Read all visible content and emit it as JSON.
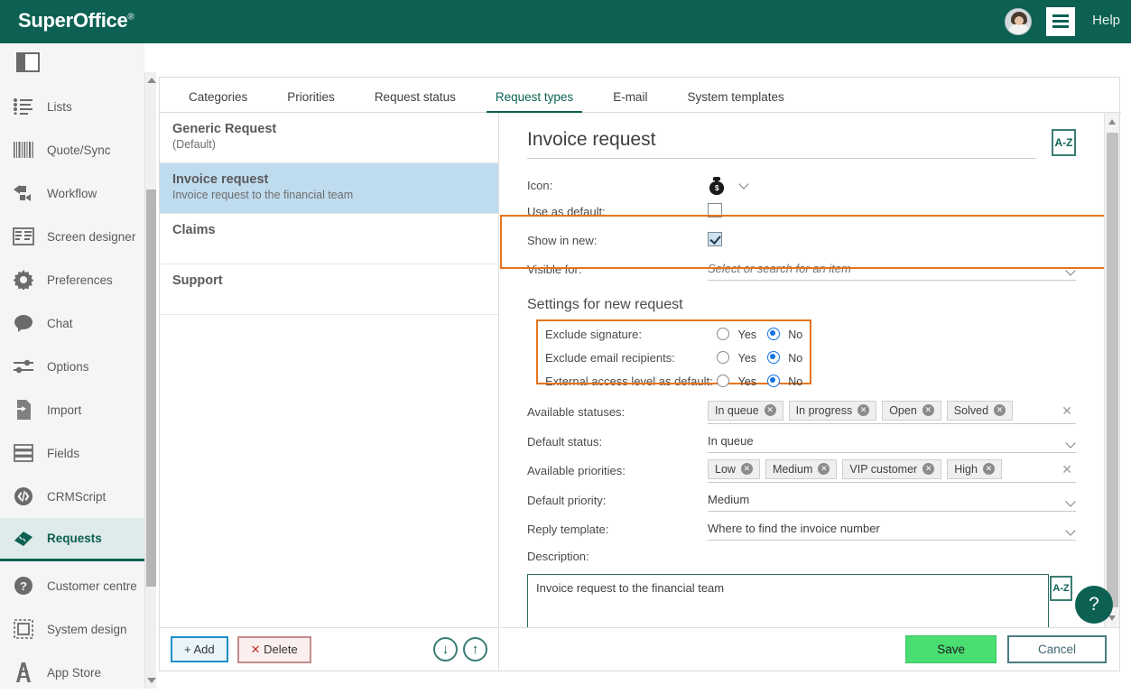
{
  "header": {
    "logo": "SuperOffice",
    "logo_mark": "®",
    "help_label": "Help",
    "brand_color": "#0c6153"
  },
  "sidebar": {
    "panel_toggle_name": "panel-toggle-icon",
    "items": [
      {
        "label": "Lists",
        "icon": "list-icon",
        "active": false
      },
      {
        "label": "Quote/Sync",
        "icon": "barcode-icon",
        "active": false
      },
      {
        "label": "Workflow",
        "icon": "workflow-icon",
        "active": false
      },
      {
        "label": "Screen designer",
        "icon": "screen-designer-icon",
        "active": false
      },
      {
        "label": "Preferences",
        "icon": "gear-icon",
        "active": false
      },
      {
        "label": "Chat",
        "icon": "chat-bubble-icon",
        "active": false
      },
      {
        "label": "Options",
        "icon": "sliders-icon",
        "active": false
      },
      {
        "label": "Import",
        "icon": "import-icon",
        "active": false
      },
      {
        "label": "Fields",
        "icon": "fields-icon",
        "active": false
      },
      {
        "label": "CRMScript",
        "icon": "code-icon",
        "active": false
      },
      {
        "label": "Requests",
        "icon": "ticket-icon",
        "active": true
      },
      {
        "label": "Customer centre",
        "icon": "question-circle-icon",
        "active": false
      },
      {
        "label": "System design",
        "icon": "system-design-icon",
        "active": false
      },
      {
        "label": "App Store",
        "icon": "app-store-icon",
        "active": false
      }
    ]
  },
  "tabs": [
    {
      "label": "Categories",
      "active": false
    },
    {
      "label": "Priorities",
      "active": false
    },
    {
      "label": "Request status",
      "active": false
    },
    {
      "label": "Request types",
      "active": true
    },
    {
      "label": "E-mail",
      "active": false
    },
    {
      "label": "System templates",
      "active": false
    }
  ],
  "request_type_list": [
    {
      "title": "Generic Request",
      "subtitle": "(Default)",
      "selected": false
    },
    {
      "title": "Invoice request",
      "subtitle": "Invoice request to the financial team",
      "selected": true
    },
    {
      "title": "Claims",
      "subtitle": "",
      "selected": false
    },
    {
      "title": "Support",
      "subtitle": "",
      "selected": false
    }
  ],
  "list_footer": {
    "add_label": "Add",
    "add_plus": "+",
    "delete_label": "Delete",
    "delete_x": "✕",
    "move_down_icon": "↓",
    "move_up_icon": "↑"
  },
  "detail": {
    "title": "Invoice request",
    "az_button_label": "A-Z",
    "fields": {
      "icon_label": "Icon:",
      "icon_value": "money-bag-icon",
      "use_as_default_label": "Use as default:",
      "use_as_default_checked": false,
      "show_in_new_label": "Show in new:",
      "show_in_new_checked": true,
      "visible_for_label": "Visible for:",
      "visible_for_placeholder": "Select or search for an item",
      "visible_for_value": ""
    },
    "settings_section": {
      "heading": "Settings for new request",
      "yes_label": "Yes",
      "no_label": "No",
      "rows": [
        {
          "label": "Exclude signature:",
          "value": "No"
        },
        {
          "label": "Exclude email recipients:",
          "value": "No"
        },
        {
          "label": "External access level as default:",
          "value": "No"
        }
      ]
    },
    "available_statuses_label": "Available statuses:",
    "available_statuses": [
      "In queue",
      "In progress",
      "Open",
      "Solved"
    ],
    "default_status_label": "Default status:",
    "default_status": "In queue",
    "available_priorities_label": "Available priorities:",
    "available_priorities": [
      "Low",
      "Medium",
      "VIP customer",
      "High"
    ],
    "default_priority_label": "Default priority:",
    "default_priority": "Medium",
    "reply_template_label": "Reply template:",
    "reply_template": "Where to find the invoice number",
    "description_label": "Description:",
    "description_value": "Invoice request to the financial team",
    "description_az_label": "A-Z",
    "clear_icon": "✕",
    "chip_remove_icon": "✕"
  },
  "detail_footer": {
    "save_label": "Save",
    "cancel_label": "Cancel"
  },
  "help_fab": "?",
  "highlight_color": "#e8741c"
}
